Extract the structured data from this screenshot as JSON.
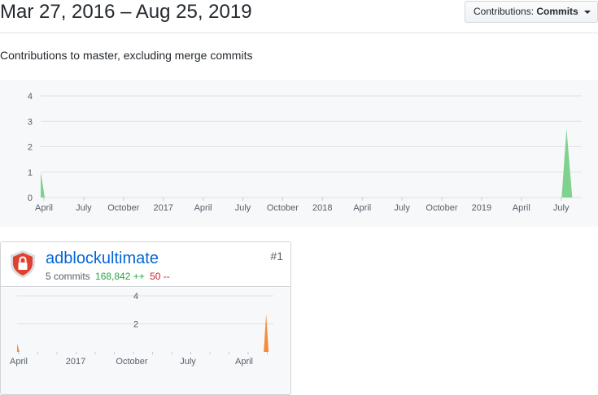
{
  "header": {
    "date_range": "Mar 27, 2016 – Aug 25, 2019",
    "dropdown_label": "Contributions:",
    "dropdown_value": "Commits"
  },
  "subtitle": "Contributions to master, excluding merge commits",
  "main_chart": {
    "y_ticks": [
      "4",
      "3",
      "2",
      "1",
      "0"
    ],
    "x_ticks": [
      "April",
      "July",
      "October",
      "2017",
      "April",
      "July",
      "October",
      "2018",
      "April",
      "July",
      "October",
      "2019",
      "April",
      "July"
    ]
  },
  "contributor": {
    "username": "adblockultimate",
    "rank": "#1",
    "commits": "5 commits",
    "additions": "168,842 ++",
    "deletions": "50 --",
    "avatar_icon": "shield-lock-icon",
    "y_ticks": [
      "4",
      "2"
    ],
    "x_ticks": [
      "April",
      "2017",
      "October",
      "July",
      "April"
    ]
  },
  "colors": {
    "main_area": "#7fd18e",
    "card_area": "#f78b3d",
    "link": "#0366d6",
    "additions": "#28a745",
    "deletions": "#cb2431"
  },
  "chart_data": [
    {
      "type": "area",
      "series": [
        {
          "x": [
            "2016-03-27",
            "2016-04-03",
            "2019-07-21",
            "2019-08-25"
          ],
          "values": [
            1,
            0,
            2.7,
            0
          ]
        }
      ],
      "ylim": [
        0,
        4
      ],
      "grid": true
    },
    {
      "type": "area",
      "series": [
        {
          "x": [
            "2016-03-27",
            "2016-04-03",
            "2019-07-21",
            "2019-08-25"
          ],
          "values": [
            1,
            0,
            2.7,
            0
          ]
        }
      ],
      "ylim": [
        0,
        4
      ],
      "grid": true
    }
  ]
}
